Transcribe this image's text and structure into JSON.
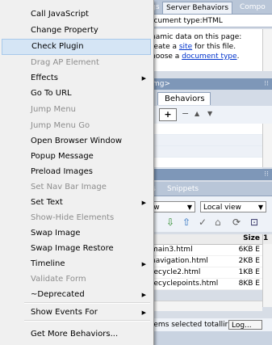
{
  "menu": {
    "items": [
      {
        "label": "Call JavaScript",
        "enabled": true
      },
      {
        "label": "Change Property",
        "enabled": true
      },
      {
        "label": "Check Plugin",
        "enabled": true,
        "highlighted": true
      },
      {
        "label": "Drag AP Element",
        "enabled": false
      },
      {
        "label": "Effects",
        "enabled": true,
        "submenu": true
      },
      {
        "label": "Go To URL",
        "enabled": true
      },
      {
        "label": "Jump Menu",
        "enabled": false
      },
      {
        "label": "Jump Menu Go",
        "enabled": false
      },
      {
        "label": "Open Browser Window",
        "enabled": true
      },
      {
        "label": "Popup Message",
        "enabled": true
      },
      {
        "label": "Preload Images",
        "enabled": true
      },
      {
        "label": "Set Nav Bar Image",
        "enabled": false
      },
      {
        "label": "Set Text",
        "enabled": true,
        "submenu": true
      },
      {
        "label": "Show-Hide Elements",
        "enabled": false
      },
      {
        "label": "Swap Image",
        "enabled": true
      },
      {
        "label": "Swap Image Restore",
        "enabled": true
      },
      {
        "label": "Timeline",
        "enabled": true,
        "submenu": true
      },
      {
        "label": "Validate Form",
        "enabled": false
      },
      {
        "label": "~Deprecated",
        "enabled": true,
        "submenu": true
      }
    ],
    "show_events_for": "Show Events For",
    "get_more_behaviors": "Get More Behaviors...",
    "submenu_arrow": "▶"
  },
  "server_panel": {
    "tab_partial_1": "ings",
    "tab_server_behaviors": "Server Behaviors",
    "tab_partial_2": "Compo",
    "document_type_line": "ocument type:HTML",
    "info_line_1": "namic data on this page:",
    "info_line_2_prefix": "reate a ",
    "info_link_site": "site",
    "info_line_2_suffix": " for this file.",
    "info_line_3_prefix": "hoose a ",
    "info_link_doctype": "document type",
    "info_line_3_suffix": "."
  },
  "tag_panel": {
    "header": "mg>",
    "behaviors_tab": "Behaviors",
    "add_button": "+",
    "grip": "⁝⁝"
  },
  "files_panel": {
    "tab_assets": "ets",
    "tab_snippets": "Snippets",
    "site_dropdown": "now",
    "view_dropdown": "Local view",
    "size_header": "Size",
    "col_partial": "1",
    "files": [
      {
        "name": "main3.html",
        "size": "6KB E"
      },
      {
        "name": "navigation.html",
        "size": "2KB E"
      },
      {
        "name": "recycle2.html",
        "size": "1KB E"
      },
      {
        "name": "recyclepoints.html",
        "size": "8KB E"
      }
    ],
    "status_text": "l items selected totallir",
    "log_button": "Log..."
  },
  "colors": {
    "menu_bg": "#f0f0f0",
    "menu_highlight": "#d5e5f5",
    "panel_header": "#7e97b8",
    "link": "#0033cc"
  }
}
